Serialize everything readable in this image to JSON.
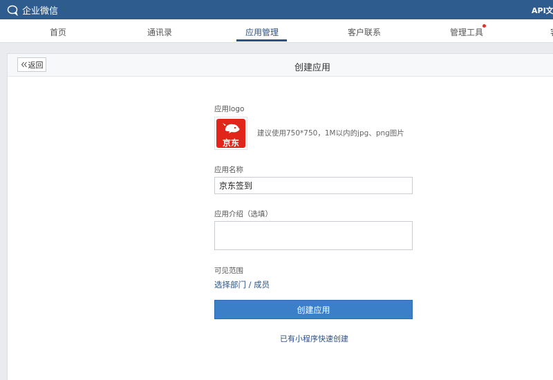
{
  "app": {
    "brand": "企业微信",
    "api_link": "API文档"
  },
  "nav": {
    "tabs": [
      {
        "label": "首页"
      },
      {
        "label": "通讯录"
      },
      {
        "label": "应用管理"
      },
      {
        "label": "客户联系"
      },
      {
        "label": "管理工具"
      }
    ],
    "active_tab": "应用管理",
    "more_label": "客"
  },
  "panel": {
    "back_label": "返回",
    "title": "创建应用"
  },
  "form": {
    "logo_label": "应用logo",
    "logo_text": "京东",
    "logo_hint": "建议使用750*750，1M以内的jpg、png图片",
    "name_label": "应用名称",
    "name_value": "京东签到",
    "intro_label": "应用介绍（选填）",
    "intro_value": "",
    "scope_label": "可见范围",
    "scope_link": "选择部门 / 成员",
    "create_button": "创建应用",
    "mini_program_link": "已有小程序快速创建"
  },
  "colors": {
    "topbar": "#2f5c8f",
    "accent": "#2b5285",
    "button": "#3b7fc8",
    "logo_red": "#e1251b",
    "notify_dot": "#e0302b"
  }
}
